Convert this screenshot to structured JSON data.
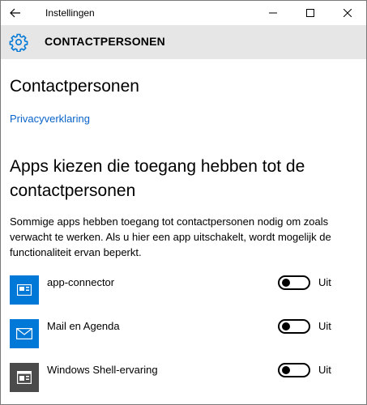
{
  "window": {
    "title": "Instellingen"
  },
  "header": {
    "title": "CONTACTPERSONEN"
  },
  "page": {
    "heading": "Contactpersonen",
    "privacy_link": "Privacyverklaring",
    "section_heading": "Apps kiezen die toegang hebben tot de contactpersonen",
    "description": "Sommige apps hebben toegang tot contactpersonen nodig om zoals verwacht te werken. Als u hier een app uitschakelt, wordt mogelijk de functionaliteit ervan beperkt."
  },
  "apps": [
    {
      "name": "app-connector",
      "state": "Uit",
      "on": false,
      "icon": "app-connector-icon",
      "tile_color": "#0078d7"
    },
    {
      "name": "Mail en Agenda",
      "state": "Uit",
      "on": false,
      "icon": "mail-envelope-icon",
      "tile_color": "#0078d7"
    },
    {
      "name": "Windows Shell-ervaring",
      "state": "Uit",
      "on": false,
      "icon": "shell-window-icon",
      "tile_color": "#4b4b4b"
    }
  ],
  "colors": {
    "accent": "#0078d7",
    "link": "#0a63c9",
    "header_band": "#e6e6e6"
  }
}
